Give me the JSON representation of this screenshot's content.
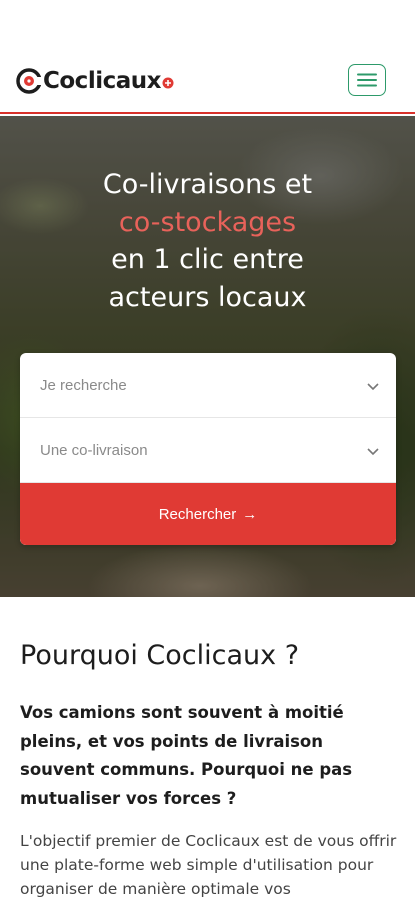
{
  "brand": {
    "name": "Coclicaux",
    "accent_color": "#e03a34",
    "menu_color": "#2d9a6a"
  },
  "header": {
    "menu_icon": "hamburger-icon"
  },
  "hero": {
    "title_line1": "Co-livraisons et",
    "title_accent": "co-stockages",
    "title_line3": "en 1 clic entre",
    "title_line4": "acteurs locaux"
  },
  "search": {
    "field1": "Je recherche",
    "field2": "Une co-livraison",
    "button_label": "Rechercher",
    "button_arrow": "→",
    "chevron_icon": "chevron-down-icon"
  },
  "why": {
    "title": "Pourquoi Coclicaux ?",
    "lead": "Vos camions sont souvent à moitié pleins, et vos points de livraison souvent communs. Pourquoi ne pas mutualiser vos forces ?",
    "body": "L'objectif premier de Coclicaux est de vous offrir une plate-forme web simple d'utilisation pour organiser de manière optimale vos"
  }
}
